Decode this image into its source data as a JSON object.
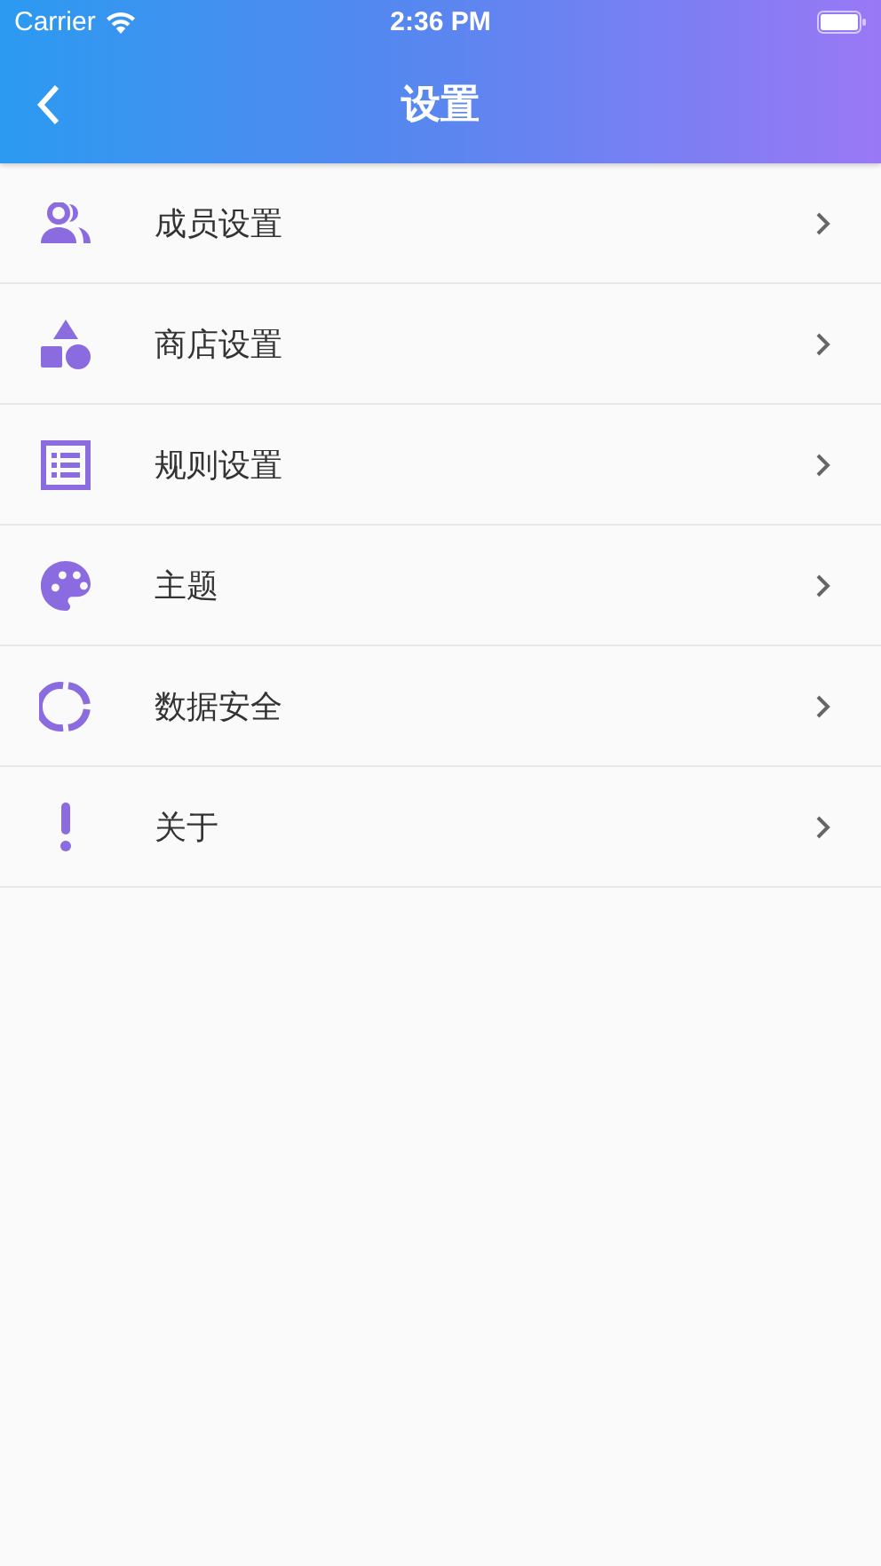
{
  "status_bar": {
    "carrier": "Carrier",
    "time": "2:36 PM"
  },
  "app_bar": {
    "title": "设置"
  },
  "items": [
    {
      "label": "成员设置"
    },
    {
      "label": "商店设置"
    },
    {
      "label": "规则设置"
    },
    {
      "label": "主题"
    },
    {
      "label": "数据安全"
    },
    {
      "label": "关于"
    }
  ]
}
